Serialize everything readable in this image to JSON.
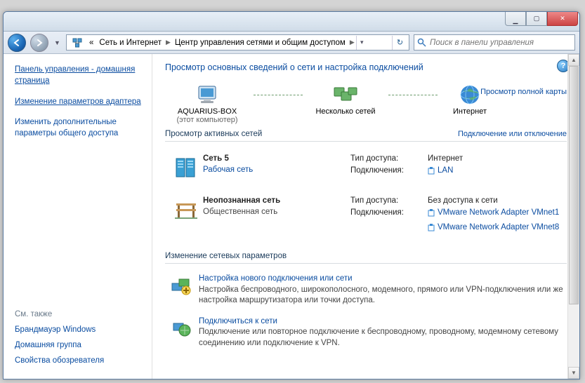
{
  "titlebar": {
    "min": "_",
    "max": "▢",
    "close": "✕"
  },
  "address": {
    "crumb1": "Сеть и Интернет",
    "crumb2": "Центр управления сетями и общим доступом"
  },
  "search": {
    "placeholder": "Поиск в панели управления"
  },
  "sidebar": {
    "home": "Панель управления - домашняя страница",
    "task1": "Изменение параметров адаптера",
    "task2": "Изменить дополнительные параметры общего доступа",
    "see_also_hdr": "См. также",
    "sa1": "Брандмауэр Windows",
    "sa2": "Домашняя группа",
    "sa3": "Свойства обозревателя"
  },
  "main": {
    "heading": "Просмотр основных сведений о сети и настройка подключений",
    "full_map": "Просмотр полной карты",
    "map": {
      "pc_name": "AQUARIUS-BOX",
      "pc_sub": "(этот компьютер)",
      "multi": "Несколько сетей",
      "internet": "Интернет"
    },
    "active_hdr": "Просмотр активных сетей",
    "conn_toggle": "Подключение или отключение",
    "net1": {
      "name": "Сеть 5",
      "type": "Рабочая сеть",
      "access_lbl": "Тип доступа:",
      "access_val": "Интернет",
      "conn_lbl": "Подключения:",
      "conn_val": "LAN"
    },
    "net2": {
      "name": "Неопознанная сеть",
      "type": "Общественная сеть",
      "access_lbl": "Тип доступа:",
      "access_val": "Без доступа к сети",
      "conn_lbl": "Подключения:",
      "conn_val1": "VMware Network Adapter VMnet1",
      "conn_val2": "VMware Network Adapter VMnet8"
    },
    "change_hdr": "Изменение сетевых параметров",
    "s1": {
      "title": "Настройка нового подключения или сети",
      "desc": "Настройка беспроводного, широкополосного, модемного, прямого или VPN-подключения или же настройка маршрутизатора или точки доступа."
    },
    "s2": {
      "title": "Подключиться к сети",
      "desc": "Подключение или повторное подключение к беспроводному, проводному, модемному сетевому соединению или подключение к VPN."
    }
  }
}
